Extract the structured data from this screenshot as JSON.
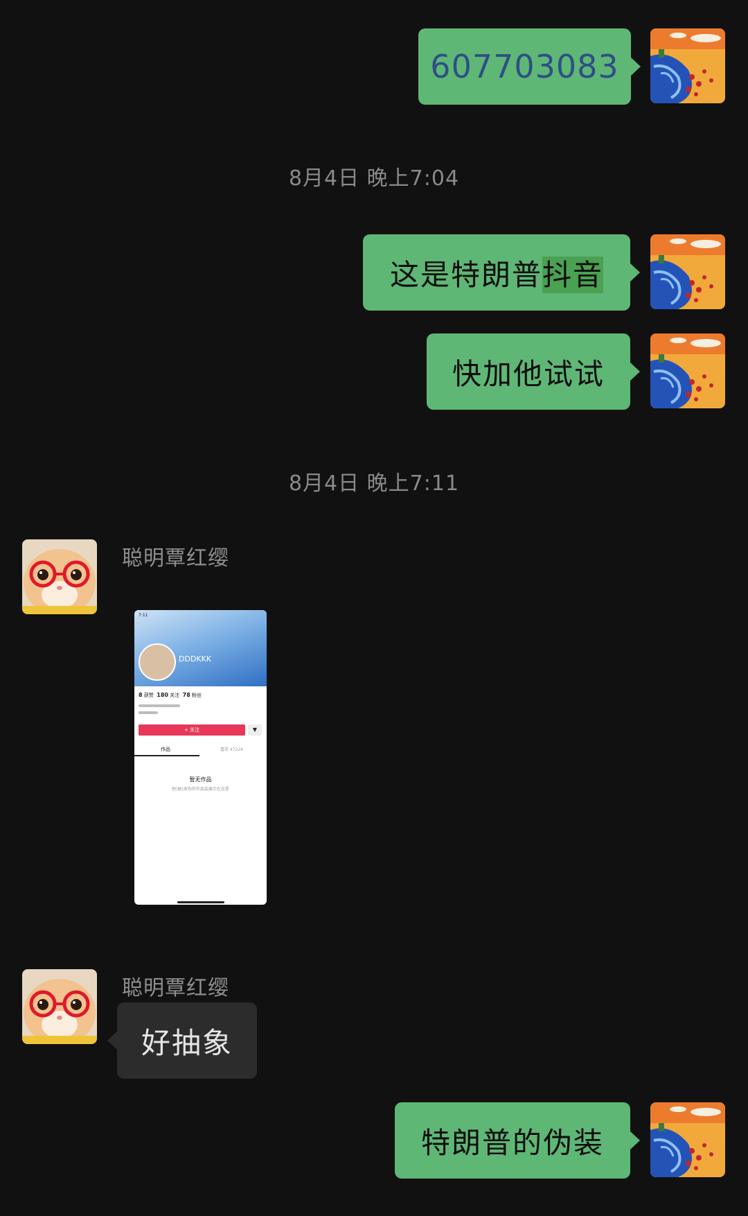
{
  "messages": {
    "m1": {
      "text": "607703083"
    },
    "t1": "8月4日 晚上7:04",
    "m2": {
      "text_main": "这是特朗普",
      "text_highlight": "抖音"
    },
    "m3": {
      "text": "快加他试试"
    },
    "t2": "8月4日 晚上7:11",
    "sender_name": "聪明覃红缨",
    "image": {
      "status_time": "7:11",
      "username": "DDDKKK",
      "stats": [
        {
          "value": "8",
          "label": "获赞"
        },
        {
          "value": "180",
          "label": "关注"
        },
        {
          "value": "78",
          "label": "粉丝"
        }
      ],
      "follow_button": "+ 关注",
      "dropdown": "▼",
      "tab_works": "作品",
      "tab_likes": "喜欢 47224",
      "empty_title": "暂无作品",
      "empty_sub": "他(她)发布的作品会展示在这里"
    },
    "m4": {
      "text": "好抽象"
    },
    "m5": {
      "text": "特朗普的伪装"
    }
  },
  "colors": {
    "background": "#111111",
    "self_bubble": "#5fb776",
    "other_bubble": "#2c2c2c",
    "timestamp": "#8a8a8a",
    "number_link": "#2e4f86"
  }
}
